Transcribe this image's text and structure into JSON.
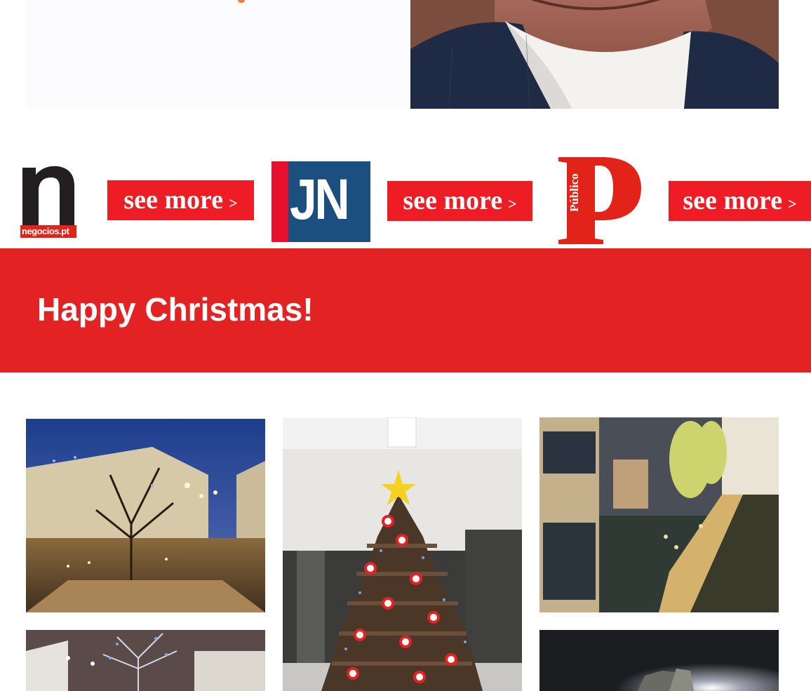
{
  "logos": [
    {
      "name": "Negocios",
      "short": "n",
      "caption": "negocios.pt",
      "see_more": "see more",
      "chevron": ">"
    },
    {
      "name": "Jornal de Noticias",
      "short": "JN",
      "see_more": "see more",
      "chevron": ">"
    },
    {
      "name": "Publico",
      "short": "P",
      "vertical": "Público",
      "see_more": "see more",
      "chevron": ">"
    }
  ],
  "banner": {
    "title": "Happy Christmas!"
  },
  "colors": {
    "brand_red": "#ee1c24",
    "banner_red": "#e32224",
    "jn_blue": "#1b4f80",
    "jn_red": "#e8112d"
  }
}
